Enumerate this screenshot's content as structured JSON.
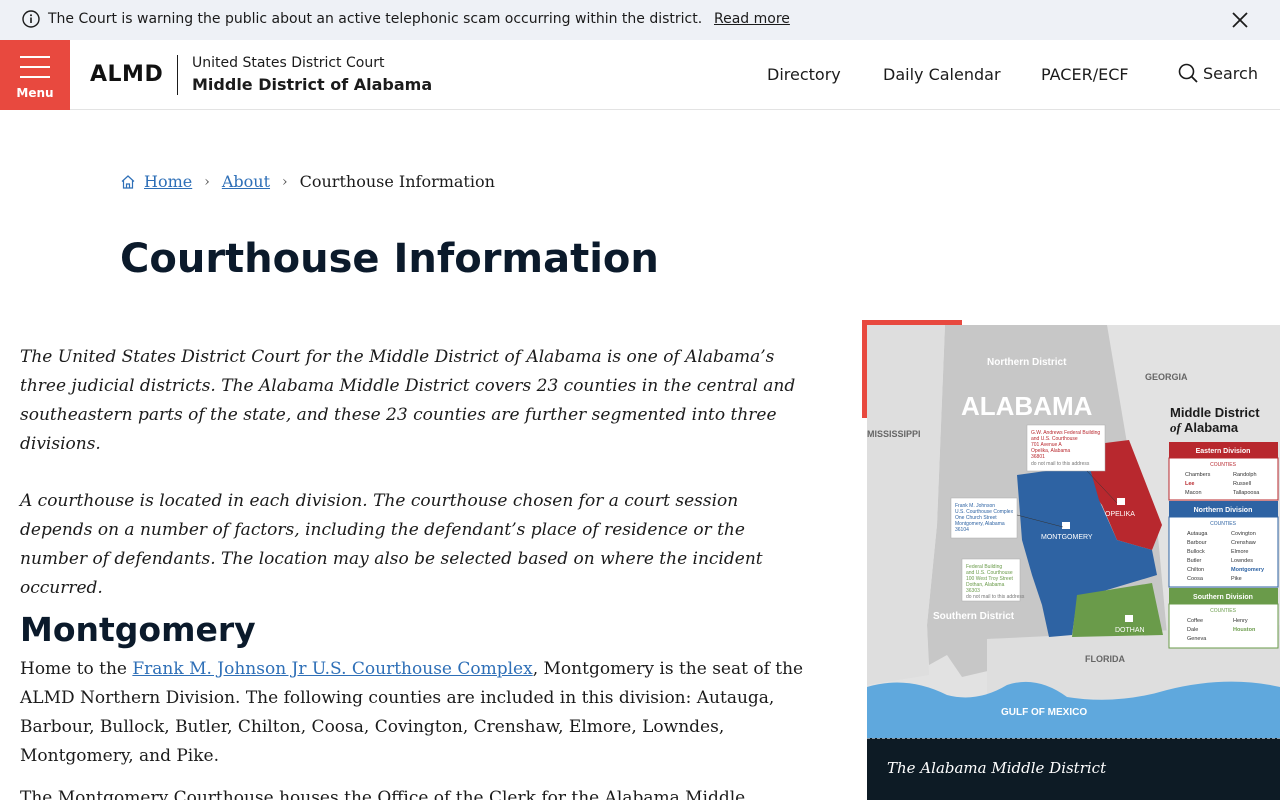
{
  "alert": {
    "message": "The Court is warning the public about an active telephonic scam occurring within the district.",
    "link_label": "Read more"
  },
  "header": {
    "menu_label": "Menu",
    "logo_abbr": "ALMD",
    "logo_line1": "United States District Court",
    "logo_line2": "Middle District of Alabama",
    "nav": [
      "Directory",
      "Daily Calendar",
      "PACER/ECF"
    ],
    "search_label": "Search"
  },
  "breadcrumb": {
    "home": "Home",
    "about": "About",
    "current": "Courthouse Information"
  },
  "page_title": "Courthouse Information",
  "intro_paragraphs": [
    "The United States District Court for the Middle District of Alabama is one of Alabama’s three judicial districts. The Alabama Middle District covers 23 counties in the central and southeastern parts of the state, and these 23 counties are further segmented into three divisions.",
    "A courthouse is located in each division. The courthouse chosen for a court session depends on a number of factors, including the defendant’s place of residence or the number of defendants. The location may also be selected based on where the incident occurred."
  ],
  "montgomery": {
    "title": "Montgomery",
    "text_before": "Home to the ",
    "link_label": "Frank M. Johnson Jr U.S. Courthouse Complex",
    "text_after": ", Montgomery is the seat of the ALMD Northern Division. The following counties are included in this division: Autauga, Barbour, Bullock, Butler, Chilton, Coosa, Covington, Crenshaw, Elmore, Lowndes, Montgomery, and Pike.",
    "next_paragraph": "The Montgomery Courthouse houses the Office of the Clerk for the Alabama Middle"
  },
  "map": {
    "caption": "The Alabama Middle District",
    "state_label": "ALABAMA",
    "northern_label": "Northern District",
    "southern_label": "Southern District",
    "georgia_label": "GEORGIA",
    "mississippi_label": "MISSISSIPPI",
    "florida_label": "FLORIDA",
    "gulf_label": "GULF OF MEXICO",
    "legend_title_1": "Middle District",
    "legend_title_2_of": "of",
    "legend_title_2": " Alabama",
    "eastern": {
      "title": "Eastern Division",
      "counties_label": "COUNTIES",
      "col1": [
        "Chambers",
        "Lee",
        "Macon"
      ],
      "col2": [
        "Randolph",
        "Russell",
        "Tallapoosa"
      ]
    },
    "northern": {
      "title": "Northern Division",
      "counties_label": "COUNTIES",
      "col1": [
        "Autauga",
        "Barbour",
        "Bullock",
        "Butler",
        "Chilton",
        "Coosa"
      ],
      "col2": [
        "Covington",
        "Crenshaw",
        "Elmore",
        "Lowndes",
        "Montgomery",
        "Pike"
      ]
    },
    "southern": {
      "title": "Southern Division",
      "counties_label": "COUNTIES",
      "col1": [
        "Coffee",
        "Dale",
        "Geneva"
      ],
      "col2": [
        "Henry",
        "Houston"
      ]
    },
    "cities": [
      "OPELIKA",
      "MONTGOMERY",
      "DOTHAN"
    ],
    "opelika_note": [
      "G.W. Andrews Federal Building",
      "and U.S. Courthouse",
      "701 Avenue A",
      "Opelika, Alabama",
      "36801",
      "do not mail to this address"
    ],
    "montgomery_note": [
      "Frank M. Johnson",
      "U.S. Courthouse Complex",
      "One Church Street",
      "Montgomery, Alabama",
      "36104"
    ],
    "dothan_note": [
      "Federal Building",
      "and U.S. Courthouse",
      "100 West Troy Street",
      "Dothan, Alabama",
      "36303",
      "do not mail to this address"
    ],
    "colors": {
      "eastern": "#b8282e",
      "northern": "#2e63a3",
      "southern": "#6a9b4a",
      "water": "#5fa8dd",
      "land": "#c7c7c7"
    }
  },
  "colors": {
    "accent": "#e8493f",
    "link": "#2e6fb7",
    "alert_bg": "#eef1f6",
    "caption_bg": "#0d1b25"
  }
}
